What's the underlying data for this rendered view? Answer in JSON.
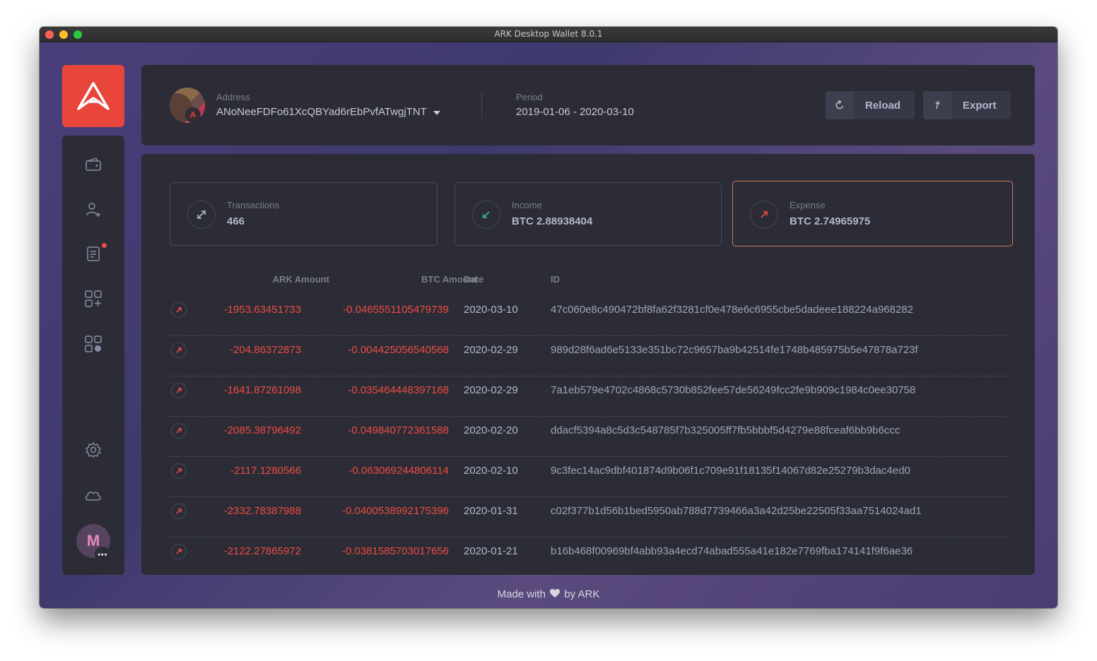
{
  "window": {
    "title": "ARK Desktop Wallet 8.0.1"
  },
  "colors": {
    "brand": "#e9463b",
    "panel": "#2b2c36",
    "expense": "#ef4b42",
    "income": "#3fb27f",
    "expense_border": "#d2765f"
  },
  "sidebar": {
    "items": [
      {
        "icon": "wallet-icon"
      },
      {
        "icon": "add-contact-icon"
      },
      {
        "icon": "announcements-icon",
        "notification": true
      },
      {
        "icon": "add-plugin-icon"
      },
      {
        "icon": "plugins-icon"
      },
      {
        "icon": "settings-icon"
      },
      {
        "icon": "cloud-icon"
      }
    ],
    "profile_initial": "M",
    "profile_more": "•••"
  },
  "header": {
    "address_label": "Address",
    "address_value": "ANoNeeFDFo61XcQBYad6rEbPvfATwgjTNT",
    "badge_letter": "A",
    "period_label": "Period",
    "period_value": "2019-01-06 - 2020-03-10",
    "reload_label": "Reload",
    "export_label": "Export"
  },
  "stats": {
    "transactions": {
      "label": "Transactions",
      "value": "466"
    },
    "income": {
      "label": "Income",
      "value": "BTC 2.88938404"
    },
    "expense": {
      "label": "Expense",
      "value": "BTC 2.74965975"
    }
  },
  "table": {
    "columns": {
      "ark": "ARK Amount",
      "btc": "BTC Amount",
      "date": "Date",
      "id": "ID"
    },
    "rows": [
      {
        "ark": "-1953.63451733",
        "btc": "-0.0465551105479739",
        "date": "2020-03-10",
        "id": "47c060e8c490472bf8fa62f3281cf0e478e6c6955cbe5dadeee188224a968282"
      },
      {
        "ark": "-204.86372873",
        "btc": "-0.004425056540568",
        "date": "2020-02-29",
        "id": "989d28f6ad6e5133e351bc72c9657ba9b42514fe1748b485975b5e47878a723f"
      },
      {
        "ark": "-1641.87261098",
        "btc": "-0.035464448397168",
        "date": "2020-02-29",
        "id": "7a1eb579e4702c4868c5730b852fee57de56249fcc2fe9b909c1984c0ee30758"
      },
      {
        "ark": "-2085.38796492",
        "btc": "-0.049840772361588",
        "date": "2020-02-20",
        "id": "ddacf5394a8c5d3c548785f7b325005ff7fb5bbbf5d4279e88fceaf6bb9b6ccc"
      },
      {
        "ark": "-2117.1280566",
        "btc": "-0.063069244806114",
        "date": "2020-02-10",
        "id": "9c3fec14ac9dbf401874d9b06f1c709e91f18135f14067d82e25279b3dac4ed0"
      },
      {
        "ark": "-2332.78387988",
        "btc": "-0.0400538992175396",
        "date": "2020-01-31",
        "id": "c02f377b1d56b1bed5950ab788d7739466a3a42d25be22505f33aa7514024ad1"
      },
      {
        "ark": "-2122.27865972",
        "btc": "-0.0381585703017656",
        "date": "2020-01-21",
        "id": "b16b468f00969bf4abb93a4ecd74abad555a41e182e7769fba174141f9f6ae36"
      }
    ]
  },
  "footer": {
    "prefix": "Made with",
    "suffix": "by ARK"
  }
}
